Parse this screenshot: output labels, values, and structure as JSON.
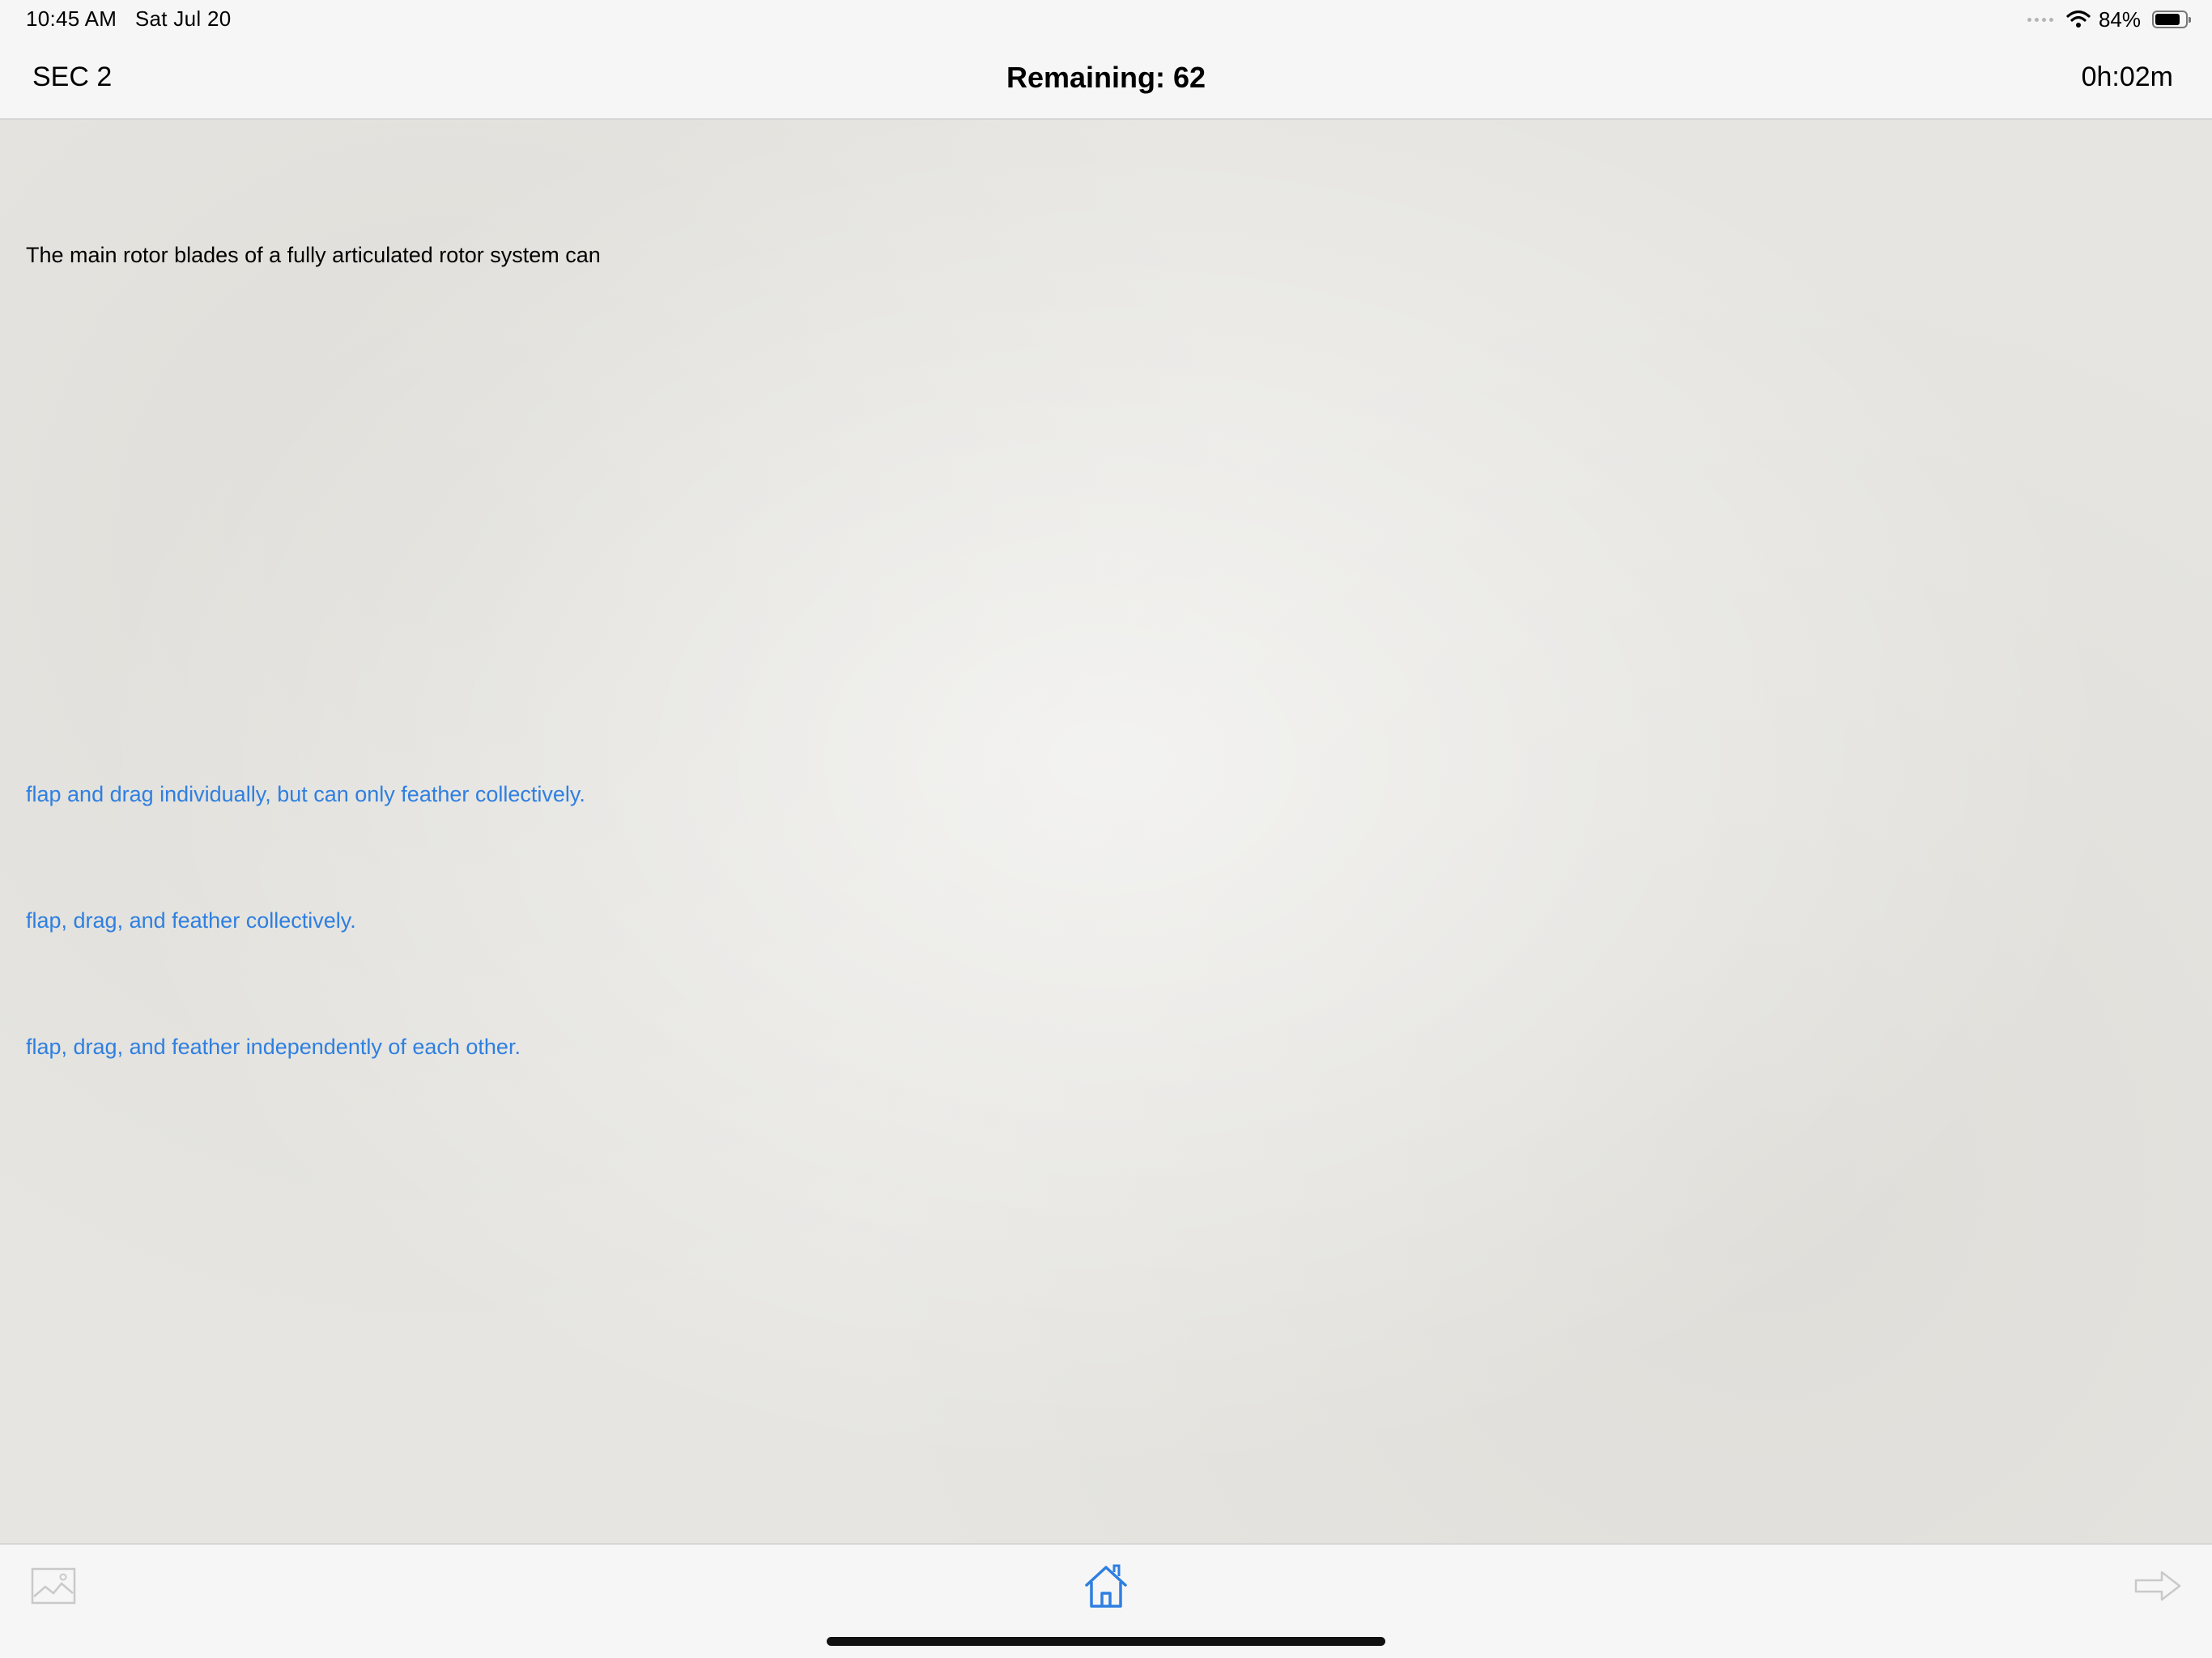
{
  "status_bar": {
    "time": "10:45 AM",
    "date": "Sat Jul 20",
    "battery_percent": "84%",
    "battery_level": 0.84,
    "icons": [
      "signal-dots-icon",
      "wifi-icon",
      "battery-icon"
    ]
  },
  "nav": {
    "section": "SEC 2",
    "title": "Remaining: 62",
    "timer": "0h:02m"
  },
  "question": {
    "text": "The main rotor blades of a fully articulated rotor system can"
  },
  "answers": [
    {
      "text": "flap and drag individually, but can only feather collectively."
    },
    {
      "text": "flap, drag, and feather collectively."
    },
    {
      "text": "flap, drag, and feather independently of each other."
    }
  ],
  "toolbar": {
    "icons": [
      "image-icon",
      "home-icon",
      "arrow-right-icon"
    ]
  },
  "colors": {
    "accent": "#2f7fe0",
    "background": "#e6e5e1",
    "bar": "#f6f6f6"
  }
}
